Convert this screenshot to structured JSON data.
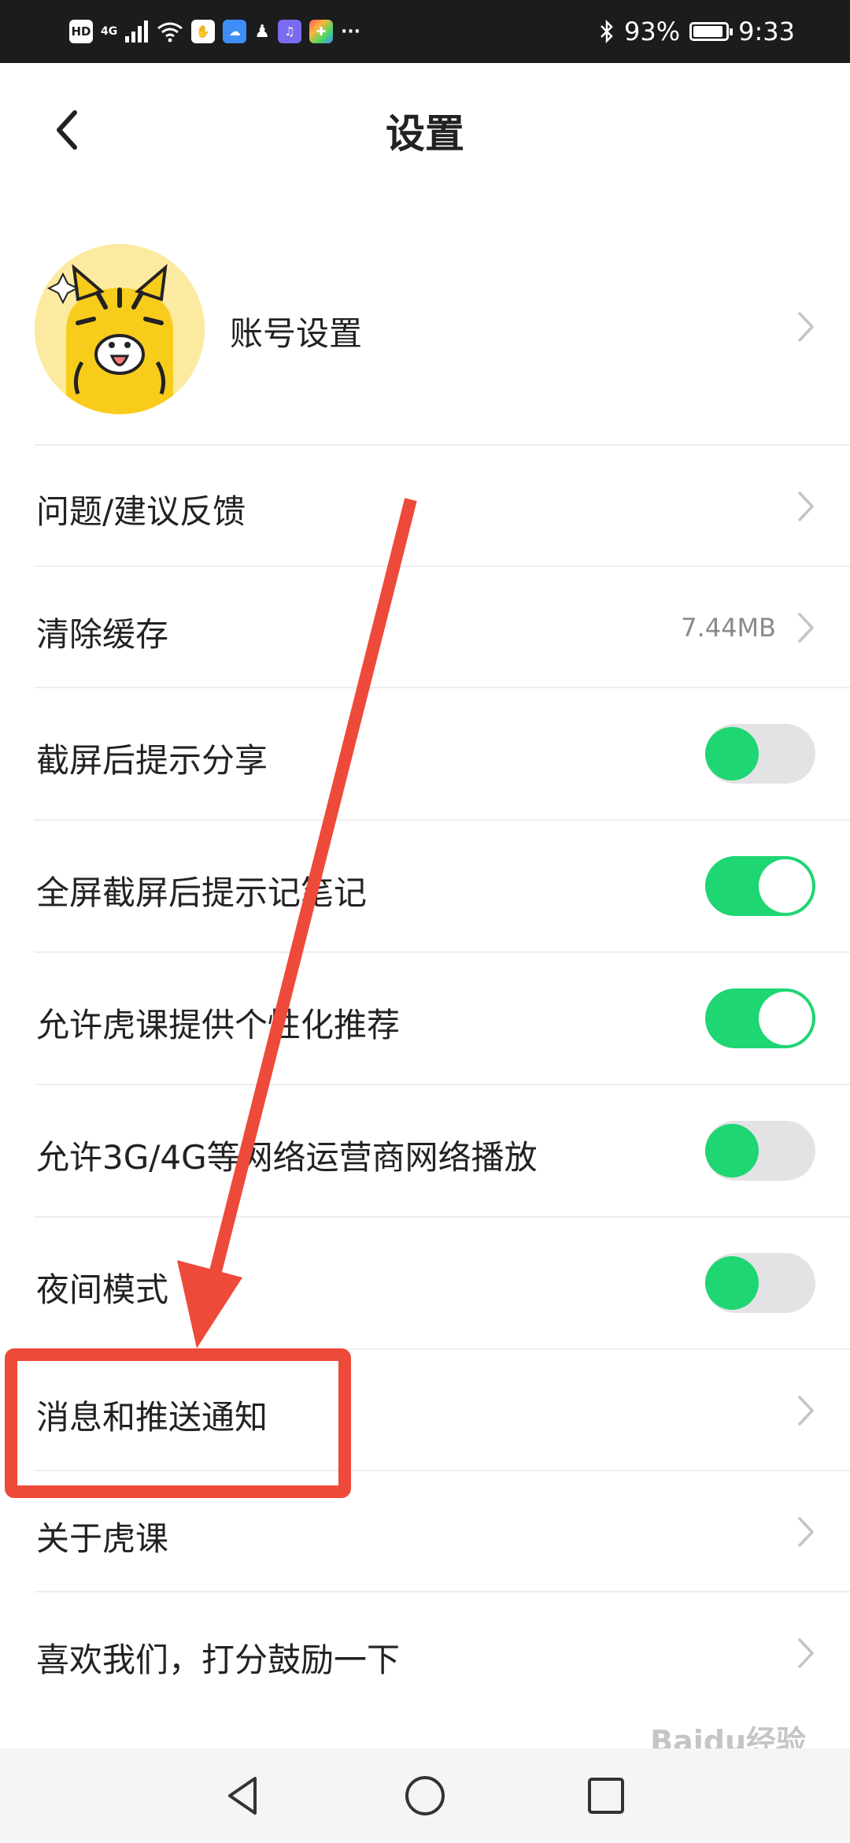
{
  "status_bar": {
    "left_icons": [
      "HD",
      "4G",
      "signal-icon",
      "wifi-icon",
      "hand-icon",
      "cloud-icon",
      "penguin-icon",
      "music-icon",
      "app-icon",
      "more-icon"
    ],
    "hd_label": "HD",
    "net_label": "4G",
    "more_label": "···",
    "battery_percent": "93%",
    "battery_level": 0.93,
    "time": "9:33"
  },
  "header": {
    "title": "设置"
  },
  "account": {
    "label": "账号设置"
  },
  "items": [
    {
      "label": "问题/建议反馈",
      "type": "nav"
    },
    {
      "label": "清除缓存",
      "type": "value",
      "value": "7.44MB"
    },
    {
      "label": "截屏后提示分享",
      "type": "toggle",
      "on": false
    },
    {
      "label": "全屏截屏后提示记笔记",
      "type": "toggle",
      "on": true
    },
    {
      "label": "允许虎课提供个性化推荐",
      "type": "toggle",
      "on": true
    },
    {
      "label": "允许3G/4G等网络运营商网络播放",
      "type": "toggle",
      "on": false
    },
    {
      "label": "夜间模式",
      "type": "toggle",
      "on": false
    },
    {
      "label": "消息和推送通知",
      "type": "nav"
    },
    {
      "label": "关于虎课",
      "type": "nav"
    },
    {
      "label": "喜欢我们，打分鼓励一下",
      "type": "nav"
    }
  ],
  "watermark": "Baidu经验",
  "colors": {
    "accent_green": "#1ed672",
    "annotation_red": "#ee4a3a"
  }
}
